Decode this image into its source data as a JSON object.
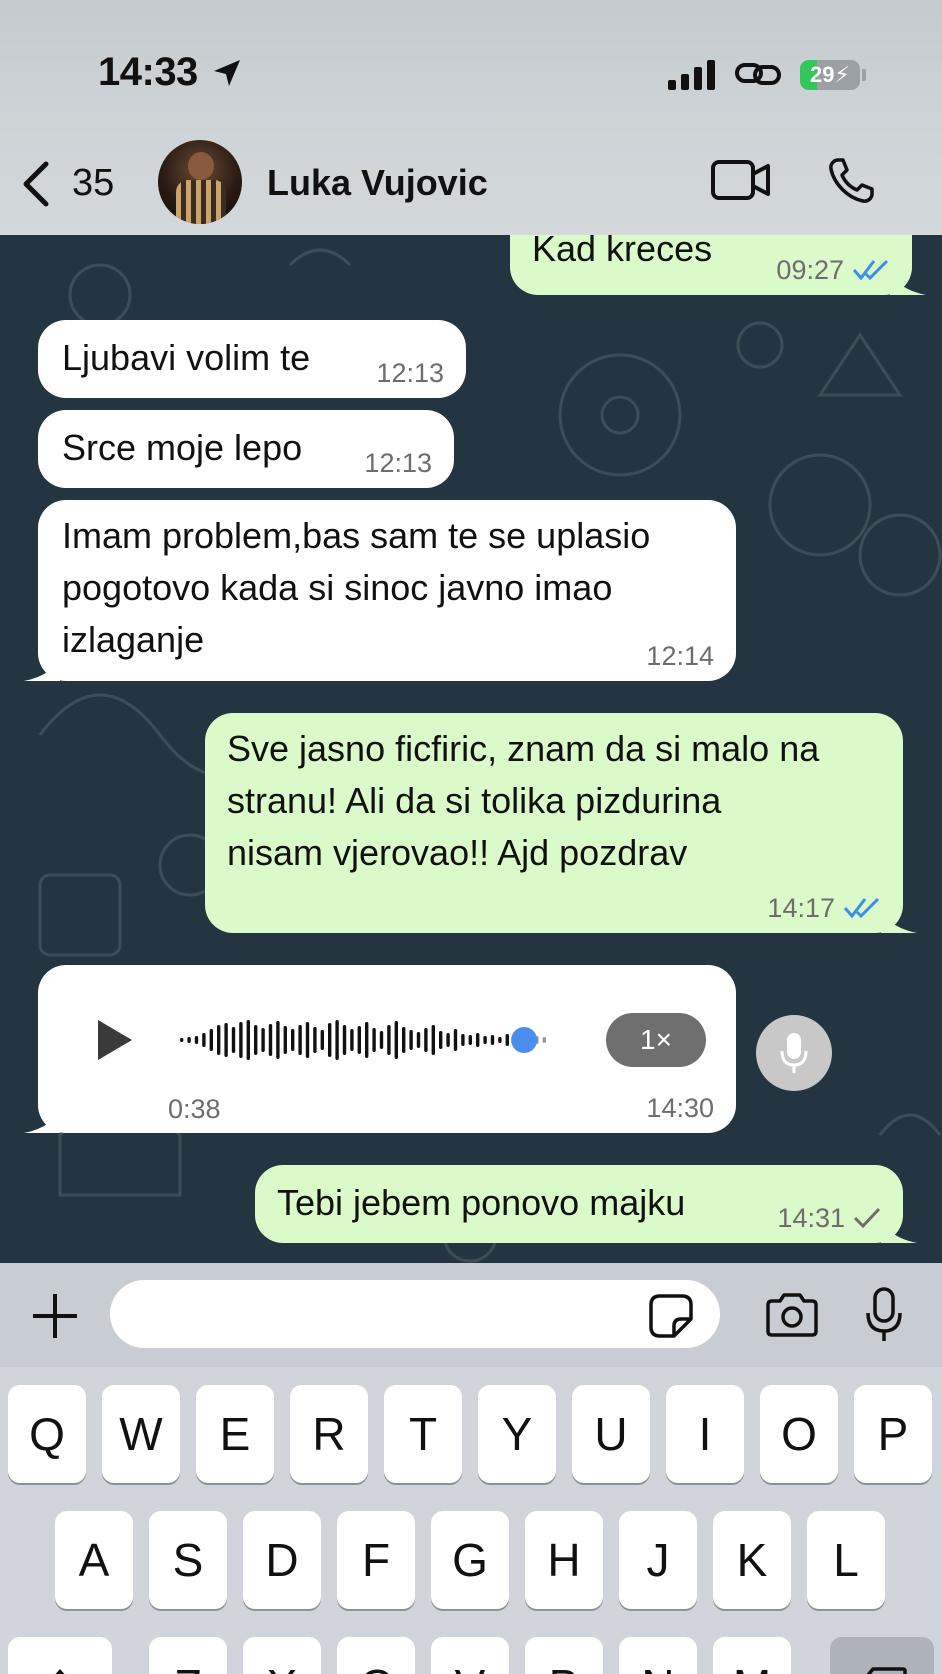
{
  "status_bar": {
    "time": "14:33",
    "battery": "29",
    "battery_level": 0.29,
    "location_icon": "location-arrow-icon",
    "signal_icon": "cellular-signal-icon",
    "hotspot_icon": "personal-hotspot-icon",
    "charging_icon": "bolt-icon"
  },
  "header": {
    "back_count": "35",
    "contact_name": "Luka Vujovic",
    "video_icon": "video-call-icon",
    "phone_icon": "phone-call-icon"
  },
  "messages": [
    {
      "direction": "out",
      "text": "Kad kreces",
      "time": "09:27",
      "status": "read"
    },
    {
      "direction": "in",
      "text": "Ljubavi volim te",
      "time": "12:13"
    },
    {
      "direction": "in",
      "text": "Srce moje lepo",
      "time": "12:13"
    },
    {
      "direction": "in",
      "lines": [
        "Imam problem,bas sam te se uplasio",
        "pogotovo kada si sinoc javno imao",
        "izlaganje"
      ],
      "time": "12:14"
    },
    {
      "direction": "out",
      "lines": [
        "Sve jasno ficfiric, znam da si malo na",
        "stranu! Ali da si tolika pizdurina",
        "nisam vjerovao!! Ajd pozdrav"
      ],
      "time": "14:17",
      "status": "read"
    },
    {
      "direction": "in",
      "type": "voice",
      "duration": "0:38",
      "speed": "1×",
      "time": "14:30",
      "progress": 0.93
    },
    {
      "direction": "out",
      "text": "Tebi jebem ponovo majku",
      "time": "14:31",
      "status": "sent"
    }
  ],
  "input_bar": {
    "placeholder": "",
    "icons": [
      "plus-icon",
      "sticker-icon",
      "camera-icon",
      "microphone-icon"
    ]
  },
  "keyboard": {
    "row1": [
      "Q",
      "W",
      "E",
      "R",
      "T",
      "Y",
      "U",
      "I",
      "O",
      "P"
    ],
    "row2": [
      "A",
      "S",
      "D",
      "F",
      "G",
      "H",
      "J",
      "K",
      "L"
    ],
    "row3": [
      "Z",
      "X",
      "C",
      "V",
      "B",
      "N",
      "M"
    ]
  },
  "colors": {
    "chat_background": "#233540",
    "incoming_bubble": "#ffffff",
    "outgoing_bubble": "#dbfac9",
    "read_ticks": "#3b8ef0",
    "battery_green": "#33c759"
  }
}
